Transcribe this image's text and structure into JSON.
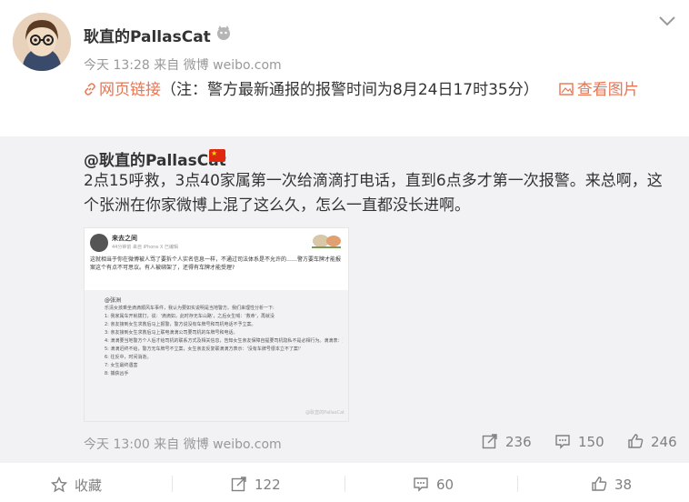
{
  "post": {
    "author": "耿直的PallasCat",
    "meta": "今天 13:28 来自 微博 weibo.com",
    "link_label": "网页链接",
    "text": "（注：警方最新通报的报警时间为8月24日17时35分）",
    "image_link_label": "查看图片"
  },
  "repost": {
    "author": "@耿直的PallasCat",
    "text": "2点15呼救，3点40家属第一次给滴滴打电话，直到6点多才第一次报警。来总啊，这个张洲在你家微博上混了这么久，怎么一直都没长进啊。",
    "time": "今天 13:00 来自 微博 weibo.com",
    "reposts": "236",
    "comments": "150",
    "likes": "246",
    "image": {
      "name": "来去之间",
      "meta": "44分钟前 来自 iPhone X 已编辑",
      "body": "这就相当于你在微博被人骂了要拆个人实名信息一样，不通过司法体系是不允许的……警方要车牌才能报案这个有点不可思议。有人被绑架了，还得有车牌才能受理?",
      "inner_user": "@张洲",
      "lines": [
        "乐清女孩乘坐滴滴顺风车事件，我认为要如实说明是当地警方。我们来理性分析一下:",
        "1: 我家属车开就拨打，说：'滴滴如，此时存无车山路'，之后女生喊：'救命'，再就没",
        "2: 亲友接到女生求救后马上报警，警方说没有车牌号和司机电话不予立案。",
        "3: 亲友接到女生求救后马上联电滴滴公司要司机的车牌号和电话。",
        "4: 滴滴要当地警方个人后才给司机的联系方式及相关信息，告知女生亲友保障自提要司机隐私不是必相行为。滴滴表：建议发及时报警，如果警方需要任何信息，我们会全力配合。",
        "5: 滴滴迟终不给，警方无车牌号不立案，女生亲友反复联滴滴方表示：'没有车牌号很本立不了案!'",
        "6: 往反中，时间消逝。",
        "7: 女生最终遇害",
        "8: 捕获凶手"
      ],
      "watermark": "@耿直的PallasCat"
    }
  },
  "bar": {
    "favorite": "收藏",
    "forward": "122",
    "comment": "60",
    "like": "38"
  }
}
